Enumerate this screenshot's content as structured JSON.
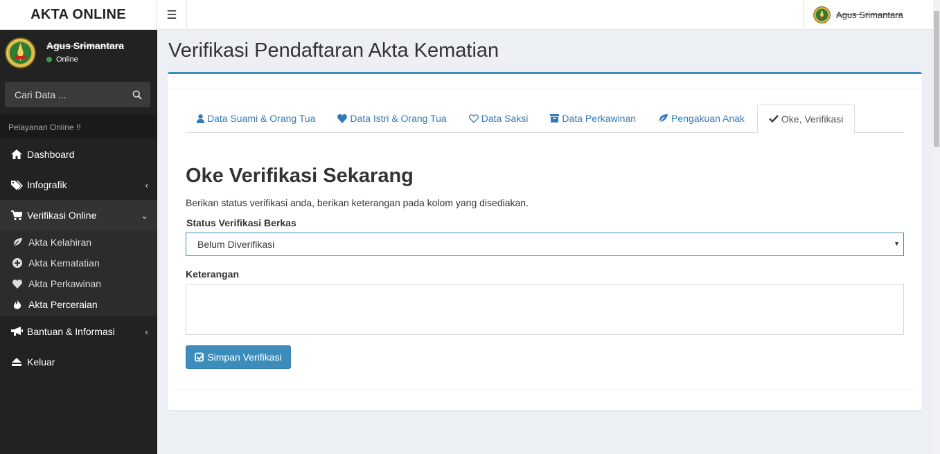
{
  "brand": {
    "title": "AKTA ONLINE"
  },
  "topbar": {
    "user_name": "Agus Srimantara"
  },
  "sidebar": {
    "user_name": "Agus Srimantara",
    "status": "Online",
    "search_placeholder": "Cari Data ...",
    "header": "Pelayanan Online !!",
    "items": [
      {
        "label": "Dashboard",
        "icon": "home-icon"
      },
      {
        "label": "Infografik",
        "icon": "tags-icon"
      },
      {
        "label": "Verifikasi Online",
        "icon": "cart-icon"
      },
      {
        "label": "Bantuan & Informasi",
        "icon": "bullhorn-icon"
      },
      {
        "label": "Keluar",
        "icon": "eject-icon"
      }
    ],
    "subitems": [
      {
        "label": "Akta Kelahiran",
        "icon": "leaf-icon"
      },
      {
        "label": "Akta Kematatian",
        "icon": "plus-circle-icon"
      },
      {
        "label": "Akta Perkawinan",
        "icon": "heart-icon"
      },
      {
        "label": "Akta Perceraian",
        "icon": "fire-icon"
      }
    ]
  },
  "page": {
    "title": "Verifikasi Pendaftaran Akta Kematian"
  },
  "tabs": [
    {
      "label": "Data Suami & Orang Tua",
      "icon": "user-icon"
    },
    {
      "label": "Data Istri & Orang Tua",
      "icon": "heart-icon"
    },
    {
      "label": "Data Saksi",
      "icon": "heart-outline-icon"
    },
    {
      "label": "Data Perkawinan",
      "icon": "archive-icon"
    },
    {
      "label": "Pengakuan Anak",
      "icon": "leaf-icon"
    },
    {
      "label": "Oke, Verifikasi",
      "icon": "check-icon"
    }
  ],
  "form": {
    "heading": "Oke Verifikasi Sekarang",
    "description": "Berikan status verifikasi anda, berikan keterangan pada kolom yang disediakan.",
    "status_label": "Status Verifikasi Berkas",
    "status_value": "Belum Diverifikasi",
    "note_label": "Keterangan",
    "note_value": "",
    "submit_label": "Simpan Verifikasi"
  },
  "colors": {
    "accent": "#3c8dbc",
    "sidebar_bg": "#222222",
    "content_bg": "#ecf0f5"
  }
}
